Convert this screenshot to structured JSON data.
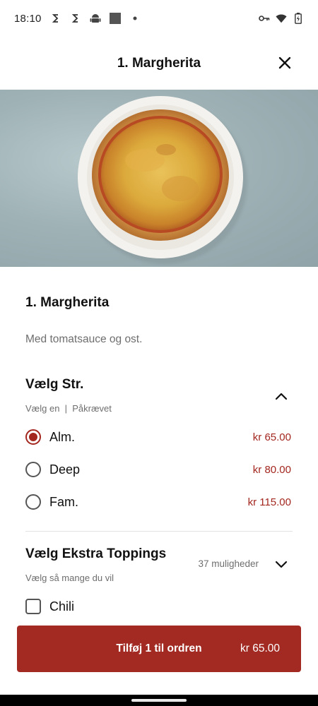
{
  "status_bar": {
    "time": "18:10",
    "left_icons": [
      "s-notification-icon",
      "s-notification-icon",
      "android-icon",
      "square-icon",
      "dot-icon"
    ],
    "right_icons": [
      "key-icon",
      "wifi-icon",
      "battery-icon"
    ]
  },
  "header": {
    "title": "1. Margherita",
    "close_icon": "close-icon"
  },
  "hero": {
    "image": "margherita-pizza-photo"
  },
  "item": {
    "title": "1. Margherita",
    "description": "Med tomatsauce og ost."
  },
  "size_section": {
    "title": "Vælg Str.",
    "subtitle": "Vælg en  |  Påkrævet",
    "expanded": true,
    "options": [
      {
        "label": "Alm.",
        "price": "kr 65.00",
        "selected": true
      },
      {
        "label": "Deep",
        "price": "kr 80.00",
        "selected": false
      },
      {
        "label": "Fam.",
        "price": "kr 115.00",
        "selected": false
      }
    ]
  },
  "toppings_section": {
    "title": "Vælg Ekstra Toppings",
    "subtitle": "Vælg så mange du vil",
    "count": "37 muligheder",
    "expanded": false,
    "options": [
      {
        "label": "Chili",
        "checked": false
      }
    ]
  },
  "cta": {
    "label": "Tilføj 1 til ordren",
    "price": "kr 65.00"
  },
  "colors": {
    "accent": "#a3261f",
    "cta_background": "#a22a22"
  }
}
